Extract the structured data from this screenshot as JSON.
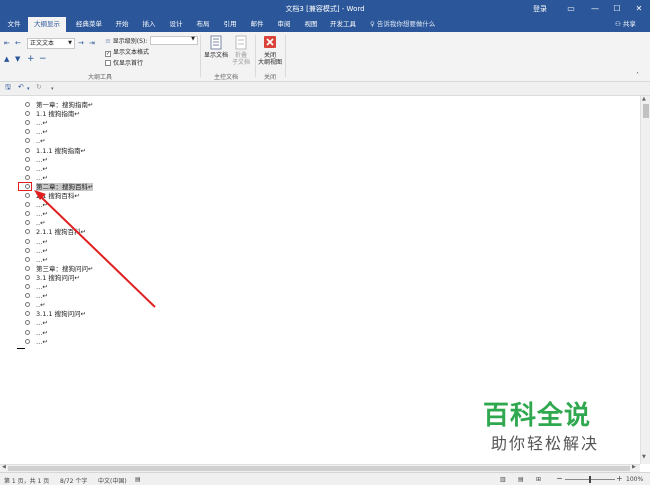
{
  "window": {
    "title": "文档3 [兼容模式] - Word",
    "login": "登录",
    "ribbon_display_icon": "ribbon-display-icon",
    "minimize": "—",
    "maximize": "☐",
    "close": "✕"
  },
  "tabs": [
    "文件",
    "大纲显示",
    "经典菜单",
    "开始",
    "插入",
    "设计",
    "布局",
    "引用",
    "邮件",
    "审阅",
    "视图",
    "开发工具"
  ],
  "active_tab": "大纲显示",
  "tell_me": "告诉我你想要做什么",
  "share": "共享",
  "ribbon": {
    "level_value": "正文文本",
    "show_level_label": "显示级别(S):",
    "show_text_format": "显示文本格式",
    "show_first_line": "仅显示首行",
    "group_outline_tools": "大纲工具",
    "show_document": "显示文档",
    "collapse_subdocs": "折叠\n子文档",
    "group_master_doc": "主控文档",
    "close_outline_line1": "关闭",
    "close_outline_line2": "大纲视图",
    "group_close": "关闭",
    "show_text_format_checked": true,
    "show_first_line_checked": false
  },
  "outline": [
    {
      "text": "第一章：搜狗指南↵",
      "indent": 0
    },
    {
      "text": "1.1 搜狗指南↵",
      "indent": 0
    },
    {
      "text": "…↵",
      "indent": 0
    },
    {
      "text": "…↵",
      "indent": 0
    },
    {
      "text": "..↵",
      "indent": 0
    },
    {
      "text": "1.1.1 搜狗指南↵",
      "indent": 0
    },
    {
      "text": "…↵",
      "indent": 0
    },
    {
      "text": "…↵",
      "indent": 0
    },
    {
      "text": "…↵",
      "indent": 0
    },
    {
      "text": "第二章：搜狗百科↵",
      "indent": 0,
      "selected": true
    },
    {
      "text": "2.1 搜狗百科↵",
      "indent": 0
    },
    {
      "text": "…↵",
      "indent": 0
    },
    {
      "text": "…↵",
      "indent": 0
    },
    {
      "text": "..↵",
      "indent": 0
    },
    {
      "text": "2.1.1 搜狗百科↵",
      "indent": 0
    },
    {
      "text": "…↵",
      "indent": 0
    },
    {
      "text": "…↵",
      "indent": 0
    },
    {
      "text": "…↵",
      "indent": 0
    },
    {
      "text": "第三章：搜狗问问↵",
      "indent": 0
    },
    {
      "text": "3.1 搜狗问问↵",
      "indent": 0
    },
    {
      "text": "…↵",
      "indent": 0
    },
    {
      "text": "…↵",
      "indent": 0
    },
    {
      "text": "..↵",
      "indent": 0
    },
    {
      "text": "3.1.1 搜狗问问↵",
      "indent": 0
    },
    {
      "text": "…↵",
      "indent": 0
    },
    {
      "text": "…↵",
      "indent": 0
    },
    {
      "text": "…↵",
      "indent": 0
    }
  ],
  "status": {
    "page": "第 1 页，共 1 页",
    "words": "8/72 个字",
    "language": "中文(中国)",
    "zoom": "100%",
    "zoom_level_percent": 100
  },
  "watermark": {
    "main": "百科全说",
    "sub": "助你轻松解决"
  },
  "colors": {
    "word_blue": "#2b579a",
    "annotation_red": "#e02020",
    "watermark_green": "#2fa84f"
  }
}
